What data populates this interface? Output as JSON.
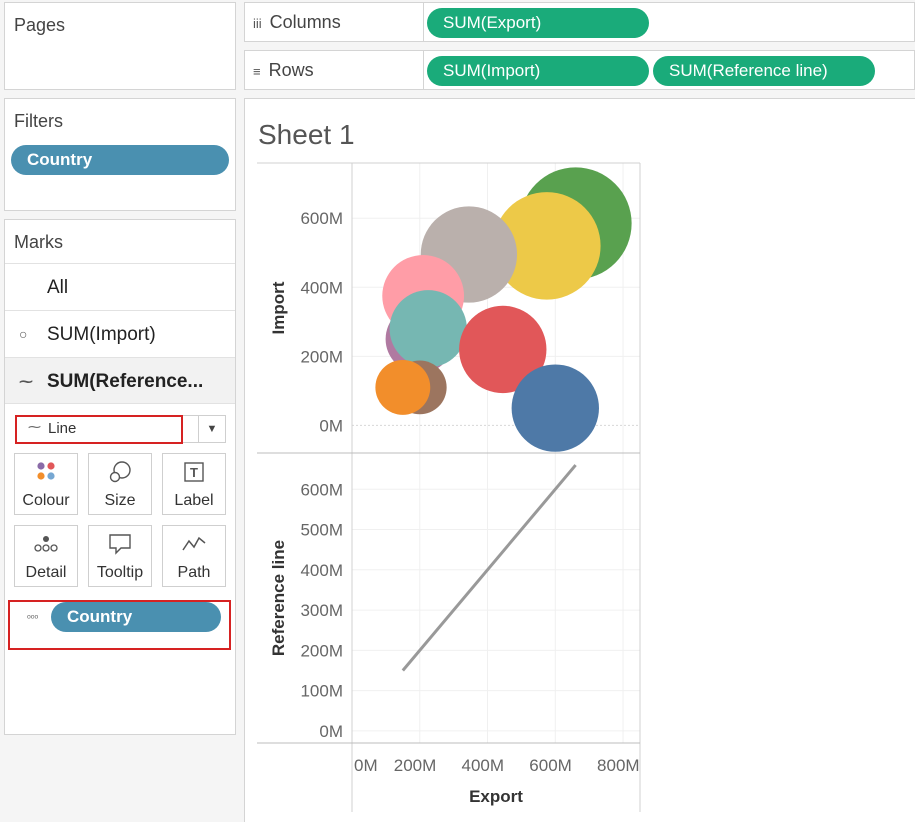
{
  "pages": {
    "title": "Pages"
  },
  "columns": {
    "label": "Columns",
    "icon": "iii",
    "pills": [
      "SUM(Export)"
    ]
  },
  "rows": {
    "label": "Rows",
    "icon": "≡",
    "pills": [
      "SUM(Import)",
      "SUM(Reference line)"
    ]
  },
  "filters": {
    "title": "Filters",
    "pill": "Country"
  },
  "marks": {
    "title": "Marks",
    "rows": [
      {
        "label": "All",
        "icon": ""
      },
      {
        "label": "SUM(Import)",
        "icon": "circle-icon"
      },
      {
        "label": "SUM(Reference...",
        "icon": "line-icon"
      }
    ],
    "mark_type": "Line",
    "cards": [
      "Colour",
      "Size",
      "Label",
      "Detail",
      "Tooltip",
      "Path"
    ],
    "detail_pill": "Country"
  },
  "sheet": {
    "title": "Sheet 1"
  },
  "colors": {
    "accent_green": "#1aab7a",
    "accent_blue": "#4a90b0",
    "highlight_red": "#d62222"
  },
  "chart_data": [
    {
      "type": "scatter",
      "encoding": "bubble",
      "xlabel": "Export",
      "ylabel": "Import",
      "x_ticks": [
        "0M",
        "200M",
        "400M",
        "600M",
        "800M"
      ],
      "y_ticks": [
        "0M",
        "200M",
        "400M",
        "600M"
      ],
      "xlim": [
        0,
        850
      ],
      "ylim": [
        -80,
        760
      ],
      "units": "M",
      "points": [
        {
          "x": 660,
          "y": 585,
          "size": 1.0,
          "color": "#59a14f"
        },
        {
          "x": 575,
          "y": 520,
          "size": 0.96,
          "color": "#edc948"
        },
        {
          "x": 345,
          "y": 495,
          "size": 0.86,
          "color": "#bab0ac"
        },
        {
          "x": 210,
          "y": 375,
          "size": 0.73,
          "color": "#ff9da7"
        },
        {
          "x": 200,
          "y": 250,
          "size": 0.61,
          "color": "#b07aa1"
        },
        {
          "x": 225,
          "y": 280,
          "size": 0.69,
          "color": "#76b7b2"
        },
        {
          "x": 445,
          "y": 220,
          "size": 0.78,
          "color": "#e15759"
        },
        {
          "x": 600,
          "y": 50,
          "size": 0.78,
          "color": "#4e79a7"
        },
        {
          "x": 200,
          "y": 110,
          "size": 0.48,
          "color": "#9c755f"
        },
        {
          "x": 150,
          "y": 110,
          "size": 0.49,
          "color": "#f28e2b"
        }
      ]
    },
    {
      "type": "line",
      "xlabel": "Export",
      "ylabel": "Reference line",
      "x_ticks": [
        "0M",
        "200M",
        "400M",
        "600M",
        "800M"
      ],
      "y_ticks": [
        "0M",
        "100M",
        "200M",
        "300M",
        "400M",
        "500M",
        "600M"
      ],
      "xlim": [
        0,
        850
      ],
      "ylim": [
        -30,
        690
      ],
      "units": "M",
      "series": [
        {
          "x": [
            150,
            660
          ],
          "y": [
            150,
            660
          ],
          "color": "#999999"
        }
      ]
    }
  ]
}
